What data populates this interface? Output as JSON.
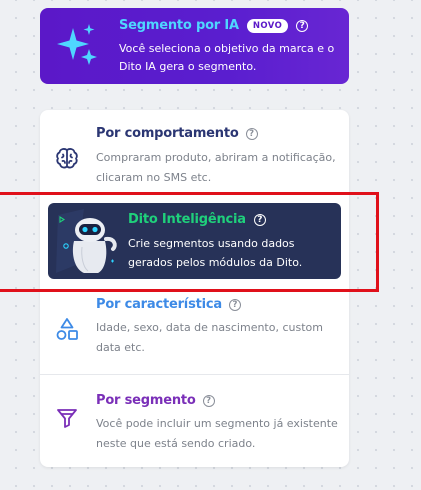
{
  "ia_card": {
    "title": "Segmento por IA",
    "badge": "NOVO",
    "description": "Você seleciona o objetivo da marca e o Dito IA gera o segmento."
  },
  "options": [
    {
      "title": "Por comportamento",
      "description": "Compraram produto, abriram a notificação, clicaram no SMS etc.",
      "icon": "brain-icon",
      "title_color": "#2b3673"
    },
    {
      "title": "Dito Inteligência",
      "description": "Crie segmentos usando dados gerados pelos módulos da Dito.",
      "icon": "robot-icon",
      "title_color": "#1fd07b"
    },
    {
      "title": "Por característica",
      "description": "Idade, sexo, data de nascimento, custom data etc.",
      "icon": "shapes-icon",
      "title_color": "#3d8ae6"
    },
    {
      "title": "Por segmento",
      "description": "Você pode incluir um segmento já existente neste que está sendo criado.",
      "icon": "funnel-icon",
      "title_color": "#7a2fb8"
    }
  ],
  "help_symbol": "?",
  "colors": {
    "ia_gradient": "#5b18c8",
    "ia_title": "#4fd6ff",
    "dito_bg": "#273258",
    "highlight": "#e0101a"
  }
}
